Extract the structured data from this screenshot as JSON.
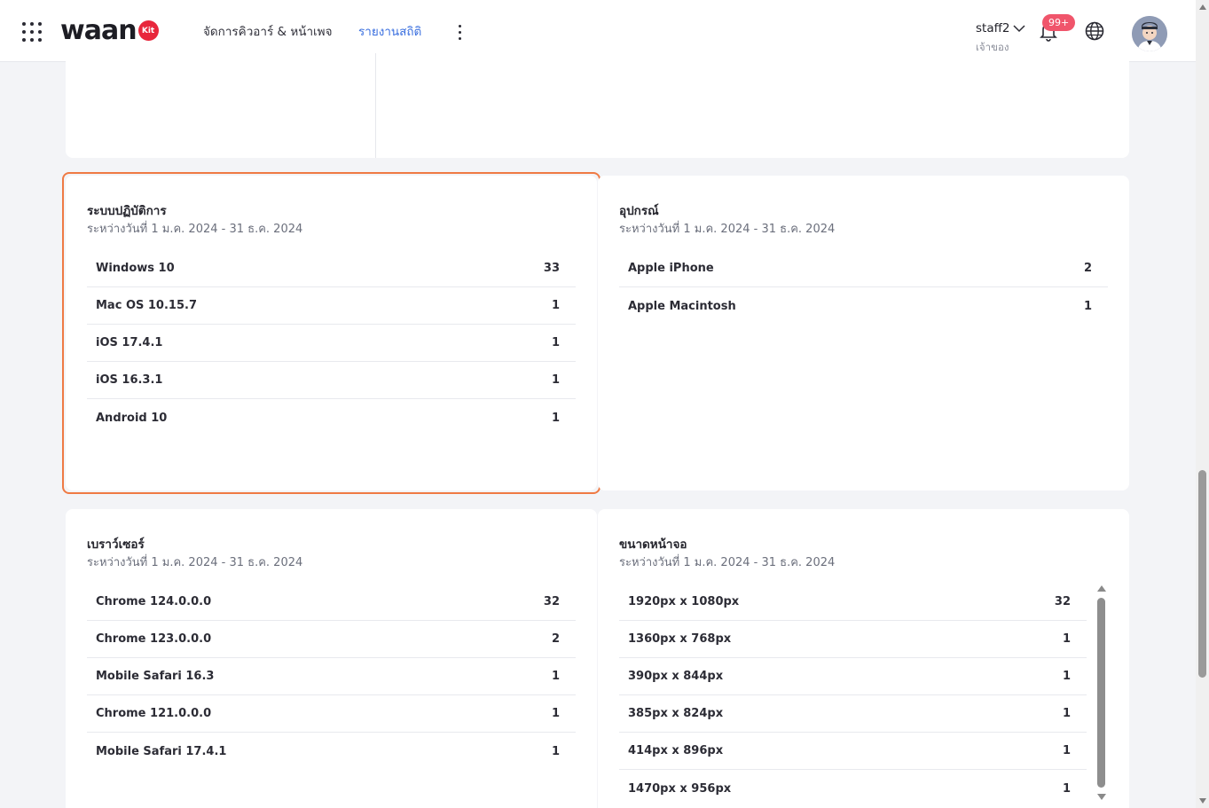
{
  "header": {
    "logo_text": "waan",
    "logo_badge": "Kit",
    "tabs": [
      {
        "label": "จัดการคิวอาร์ & หน้าเพจ",
        "active": false
      },
      {
        "label": "รายงานสถิติ",
        "active": true
      }
    ],
    "user": {
      "name": "staff2",
      "role": "เจ้าของ"
    },
    "notification_badge": "99+",
    "icons": [
      "apps-grid-icon",
      "more-vertical-icon",
      "chevron-down-icon",
      "bell-icon",
      "globe-icon",
      "avatar"
    ]
  },
  "colors": {
    "accent": "#3a6fdf",
    "highlight": "#ef7a44",
    "badge": "#f0556b",
    "logo_badge": "#e8273c"
  },
  "cards": {
    "os": {
      "title": "ระบบปฏิบัติการ",
      "subtitle": "ระหว่างวันที่ 1 ม.ค. 2024 - 31 ธ.ค. 2024",
      "rows": [
        {
          "label": "Windows 10",
          "value": "33"
        },
        {
          "label": "Mac OS 10.15.7",
          "value": "1"
        },
        {
          "label": "iOS 17.4.1",
          "value": "1"
        },
        {
          "label": "iOS 16.3.1",
          "value": "1"
        },
        {
          "label": "Android 10",
          "value": "1"
        }
      ]
    },
    "device": {
      "title": "อุปกรณ์",
      "subtitle": "ระหว่างวันที่ 1 ม.ค. 2024 - 31 ธ.ค. 2024",
      "rows": [
        {
          "label": "Apple iPhone",
          "value": "2"
        },
        {
          "label": "Apple Macintosh",
          "value": "1"
        }
      ]
    },
    "browser": {
      "title": "เบราว์เซอร์",
      "subtitle": "ระหว่างวันที่ 1 ม.ค. 2024 - 31 ธ.ค. 2024",
      "rows": [
        {
          "label": "Chrome 124.0.0.0",
          "value": "32"
        },
        {
          "label": "Chrome 123.0.0.0",
          "value": "2"
        },
        {
          "label": "Mobile Safari 16.3",
          "value": "1"
        },
        {
          "label": "Chrome 121.0.0.0",
          "value": "1"
        },
        {
          "label": "Mobile Safari 17.4.1",
          "value": "1"
        }
      ]
    },
    "screen": {
      "title": "ขนาดหน้าจอ",
      "subtitle": "ระหว่างวันที่ 1 ม.ค. 2024 - 31 ธ.ค. 2024",
      "rows": [
        {
          "label": "1920px x 1080px",
          "value": "32"
        },
        {
          "label": "1360px x 768px",
          "value": "1"
        },
        {
          "label": "390px x 844px",
          "value": "1"
        },
        {
          "label": "385px x 824px",
          "value": "1"
        },
        {
          "label": "414px x 896px",
          "value": "1"
        },
        {
          "label": "1470px x 956px",
          "value": "1"
        }
      ]
    }
  }
}
